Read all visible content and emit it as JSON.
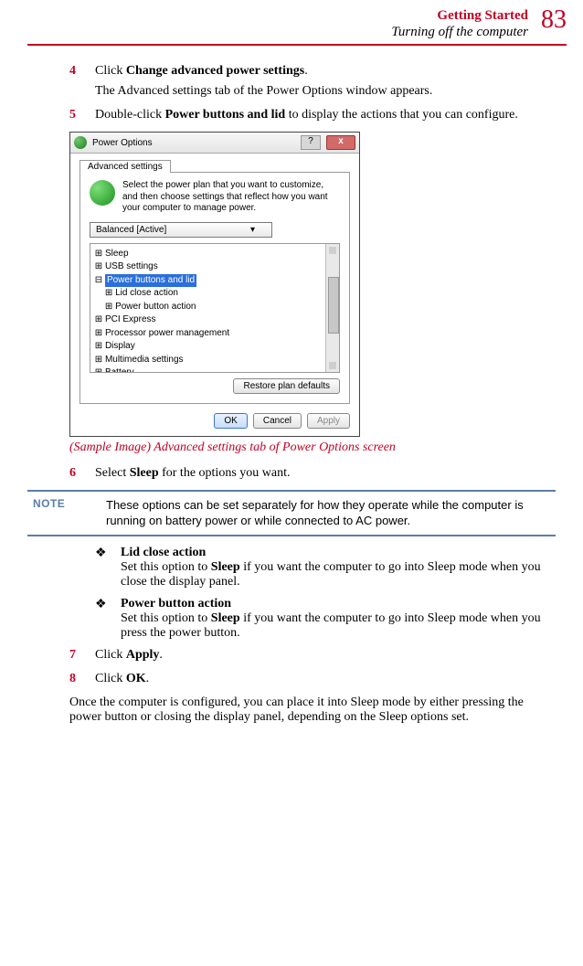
{
  "header": {
    "section": "Getting Started",
    "subsection": "Turning off the computer",
    "page_number": "83"
  },
  "steps": {
    "s4": {
      "num": "4",
      "lead": "Click ",
      "bold": "Change advanced power settings",
      "tail": ".",
      "after": "The Advanced settings tab of the Power Options window appears."
    },
    "s5": {
      "num": "5",
      "lead": "Double-click ",
      "bold": "Power buttons and lid",
      "tail": " to display the actions that you can configure."
    },
    "s6": {
      "num": "6",
      "lead": "Select ",
      "bold": "Sleep",
      "tail": " for the options you want."
    },
    "s7": {
      "num": "7",
      "lead": "Click ",
      "bold": "Apply",
      "tail": "."
    },
    "s8": {
      "num": "8",
      "lead": "Click ",
      "bold": "OK",
      "tail": "."
    }
  },
  "screenshot": {
    "window_title": "Power Options",
    "help_btn": "?",
    "close_btn": "x",
    "tab": "Advanced settings",
    "intro": "Select the power plan that you want to customize, and then choose settings that reflect how you want your computer to manage power.",
    "plan": "Balanced [Active]",
    "tree": {
      "t0": "Sleep",
      "t1": "USB settings",
      "t2": "Power buttons and lid",
      "t2a": "Lid close action",
      "t2b": "Power button action",
      "t3": "PCI Express",
      "t4": "Processor power management",
      "t5": "Display",
      "t6": "Multimedia settings",
      "t7": "Battery"
    },
    "restore": "Restore plan defaults",
    "ok": "OK",
    "cancel": "Cancel",
    "apply": "Apply"
  },
  "caption": "(Sample Image) Advanced settings tab of Power Options screen",
  "note": {
    "label": "NOTE",
    "text": "These options can be set separately for how they operate while the computer is running on battery power or while connected to AC power."
  },
  "bullets": {
    "b1_title": "Lid close action",
    "b1_lead": "Set this option to ",
    "b1_bold": "Sleep",
    "b1_tail": " if you want the computer to go into Sleep mode when you close the display panel.",
    "b2_title": "Power button action",
    "b2_lead": "Set this option to ",
    "b2_bold": "Sleep",
    "b2_tail": " if you want the computer to go into Sleep mode when you press the power button."
  },
  "closing": "Once the computer is configured, you can place it into Sleep mode by either pressing the power button or closing the display panel, depending on the Sleep options set."
}
